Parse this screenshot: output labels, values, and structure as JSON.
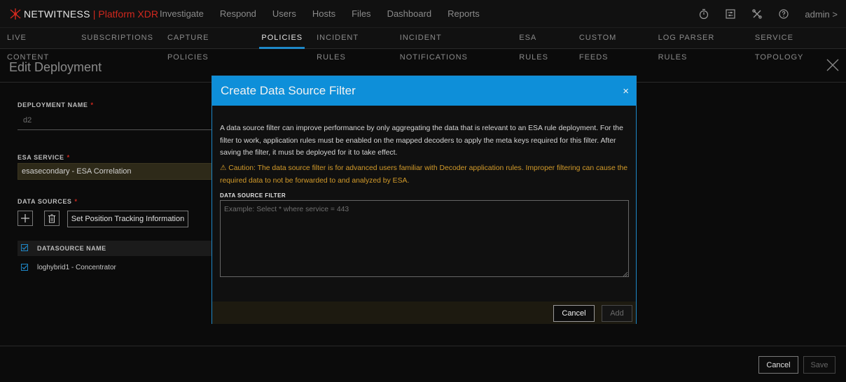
{
  "app": {
    "name": "NETWITNESS",
    "separator": "|",
    "product": "Platform XDR",
    "nav": [
      "Investigate",
      "Respond",
      "Users",
      "Hosts",
      "Files",
      "Dashboard",
      "Reports"
    ],
    "user": "admin >"
  },
  "subnav": [
    "LIVE CONTENT",
    "SUBSCRIPTIONS",
    "CAPTURE POLICIES",
    "POLICIES",
    "INCIDENT RULES",
    "INCIDENT NOTIFICATIONS",
    "ESA RULES",
    "CUSTOM FEEDS",
    "LOG PARSER RULES",
    "SERVICE TOPOLOGY"
  ],
  "panel": {
    "title": "Edit Deployment",
    "deployment_name_label": "DEPLOYMENT NAME",
    "deployment_name_value": "d2",
    "esa_service_label": "ESA SERVICE",
    "esa_service_value": "esasecondary - ESA Correlation",
    "data_sources_label": "DATA SOURCES",
    "required_mark": "*",
    "set_position_label": "Set Position Tracking Information",
    "ds_column_header": "DATASOURCE NAME",
    "ds_rows": [
      "loghybrid1 - Concentrator"
    ],
    "cancel_label": "Cancel",
    "save_label": "Save"
  },
  "modal": {
    "title": "Create Data Source Filter",
    "close": "×",
    "description": "A data source filter can improve performance by only aggregating the data that is relevant to an ESA rule deployment. For the filter to work, application rules must be enabled on the mapped decoders to apply the meta keys required for this filter. After saving the filter, it must be deployed for it to take effect.",
    "warning": "⚠ Caution: The data source filter is for advanced users familiar with Decoder application rules. Improper filtering can cause the required data to not be forwarded to and analyzed by ESA.",
    "filter_label": "DATA SOURCE FILTER",
    "filter_placeholder": "Example: Select * where service = 443",
    "filter_value": "",
    "cancel_label": "Cancel",
    "add_label": "Add"
  },
  "colors": {
    "accent": "#1e88c8",
    "modal_header": "#0e8fd9",
    "brand_red": "#d1281e",
    "warning": "#d39b2a"
  }
}
